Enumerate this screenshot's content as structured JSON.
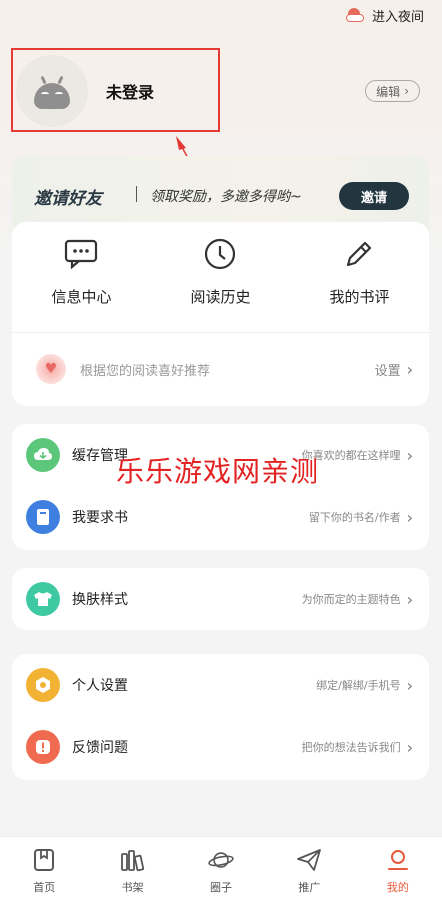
{
  "topbar": {
    "night_mode_label": "进入夜间",
    "night_icon": "sun-cloud-icon"
  },
  "profile": {
    "name": "未登录",
    "edit_label": "编辑"
  },
  "invite": {
    "title": "邀请好友",
    "subtitle": "领取奖励，多邀多得哟~",
    "button_label": "邀请"
  },
  "quick_actions": [
    {
      "label": "信息中心",
      "icon": "message-icon"
    },
    {
      "label": "阅读历史",
      "icon": "clock-icon"
    },
    {
      "label": "我的书评",
      "icon": "pencil-icon"
    }
  ],
  "recommend": {
    "text": "根据您的阅读喜好推荐",
    "setting_label": "设置"
  },
  "menu_group_1": [
    {
      "label": "缓存管理",
      "hint": "你喜欢的都在这样哩",
      "icon": "download-cloud-icon",
      "color": "#5cc77b"
    },
    {
      "label": "我要求书",
      "hint": "留下你的书名/作者",
      "icon": "book-icon",
      "color": "#3f7fe0"
    }
  ],
  "menu_group_2": [
    {
      "label": "换肤样式",
      "hint": "为你而定的主题特色",
      "icon": "shirt-icon",
      "color": "#3fc9a2"
    }
  ],
  "menu_group_3": [
    {
      "label": "个人设置",
      "hint": "绑定/解绑/手机号",
      "icon": "settings-icon",
      "color": "#f2b233"
    },
    {
      "label": "反馈问题",
      "hint": "把你的想法告诉我们",
      "icon": "alert-icon",
      "color": "#ef6a4f"
    }
  ],
  "watermark": "乐乐游戏网亲测",
  "tabs": [
    {
      "label": "首页",
      "icon": "home-book-icon",
      "active": false
    },
    {
      "label": "书架",
      "icon": "bookshelf-icon",
      "active": false
    },
    {
      "label": "圈子",
      "icon": "planet-icon",
      "active": false
    },
    {
      "label": "推广",
      "icon": "paper-plane-icon",
      "active": false
    },
    {
      "label": "我的",
      "icon": "user-icon",
      "active": true
    }
  ],
  "colors": {
    "accent": "#e85a3b",
    "annotation_red": "#e53935",
    "invite_button": "#233640"
  }
}
